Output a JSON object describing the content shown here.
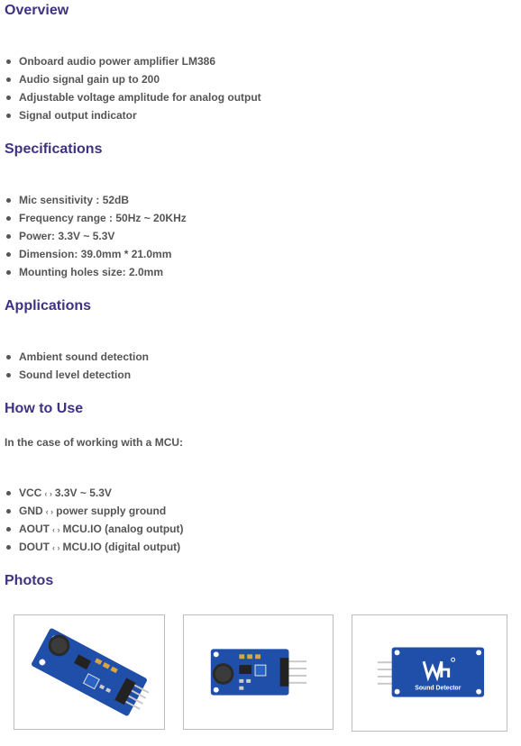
{
  "overview": {
    "heading": "Overview",
    "items": [
      "Onboard audio power amplifier LM386",
      "Audio signal gain up to 200",
      "Adjustable voltage amplitude for analog output",
      "Signal output indicator"
    ]
  },
  "specifications": {
    "heading": "Specifications",
    "items": [
      "Mic sensitivity : 52dB",
      "Frequency range : 50Hz ~ 20KHz",
      "Power: 3.3V ~ 5.3V",
      "Dimension: 39.0mm * 21.0mm",
      "Mounting holes size: 2.0mm"
    ]
  },
  "applications": {
    "heading": "Applications",
    "items": [
      "Ambient sound detection",
      "Sound level detection"
    ]
  },
  "how_to_use": {
    "heading": "How to Use",
    "intro": "In the case of working with a MCU:",
    "pins": [
      {
        "pin": "VCC",
        "arrow": "‹ ›",
        "target": "3.3V ~ 5.3V"
      },
      {
        "pin": "GND",
        "arrow": "‹ ›",
        "target": "power supply ground"
      },
      {
        "pin": "AOUT",
        "arrow": "‹ ›",
        "target": "MCU.IO (analog output)"
      },
      {
        "pin": "DOUT",
        "arrow": "‹ ›",
        "target": "MCU.IO (digital output)"
      }
    ]
  },
  "photos": {
    "heading": "Photos",
    "back_label": "Sound Detector",
    "colors": {
      "pcb": "#1f4fa8",
      "pcb_dark": "#163b80",
      "pins": "#c9c9c9",
      "mic": "#2a2a2a"
    }
  }
}
